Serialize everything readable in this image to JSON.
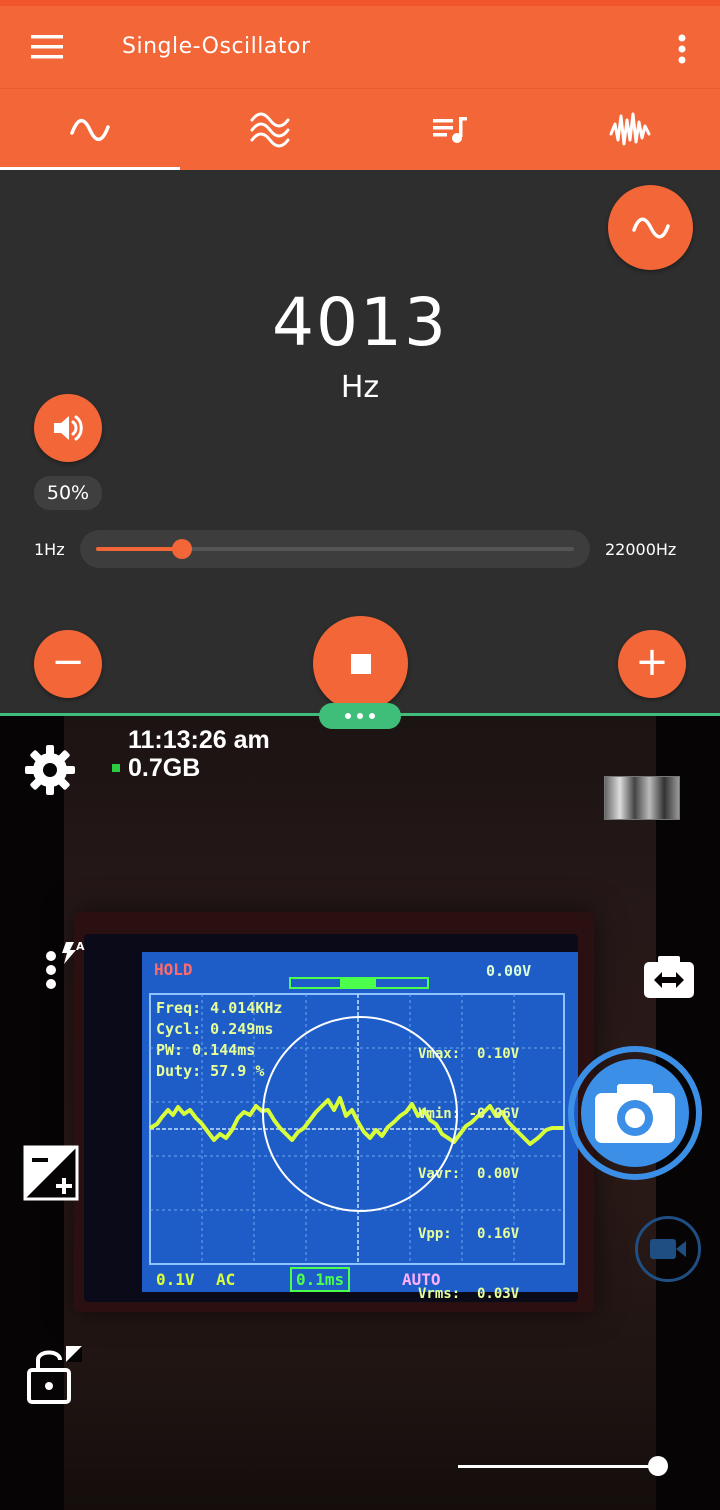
{
  "app_bar": {
    "title": "Single-Oscillator",
    "menu_icon": "hamburger-menu-icon",
    "overflow_icon": "more-vert-icon"
  },
  "tabs": [
    {
      "icon": "sine-wave-icon",
      "selected": true
    },
    {
      "icon": "multi-wave-icon",
      "selected": false
    },
    {
      "icon": "playlist-music-icon",
      "selected": false
    },
    {
      "icon": "noise-wave-icon",
      "selected": false
    }
  ],
  "oscillator": {
    "frequency": "4013",
    "unit": "Hz",
    "volume": "50%",
    "range_min": "1Hz",
    "range_max": "22000Hz",
    "slider_fraction": 0.18,
    "waveform_button_icon": "sine-wave-icon",
    "volume_icon": "volume-up-icon",
    "decrease_label": "−",
    "increase_label": "+",
    "stop_icon": "stop-icon"
  },
  "camera": {
    "time": "11:13:26 am",
    "memory": "0.7GB",
    "zoom_fraction": 1.0
  },
  "scope_screen": {
    "hold": "HOLD",
    "top_right": "0.00V",
    "left_readouts": [
      "Freq: 4.014KHz",
      "Cycl: 0.249ms",
      "PW:   0.144ms",
      "Duty: 57.9 %"
    ],
    "right_readouts": [
      "Vmax:  0.10V",
      "Vmin: -0.06V",
      "Vavr:  0.00V",
      "Vpp:   0.16V",
      "Vrms:  0.03V"
    ],
    "bottom": [
      "0.1V",
      "AC",
      "0.1ms",
      "AUTO"
    ]
  },
  "colors": {
    "accent": "#F26638",
    "panel_bg": "#2E2E2E",
    "divider": "#3FBE7A",
    "shutter": "#3B8FE6"
  }
}
